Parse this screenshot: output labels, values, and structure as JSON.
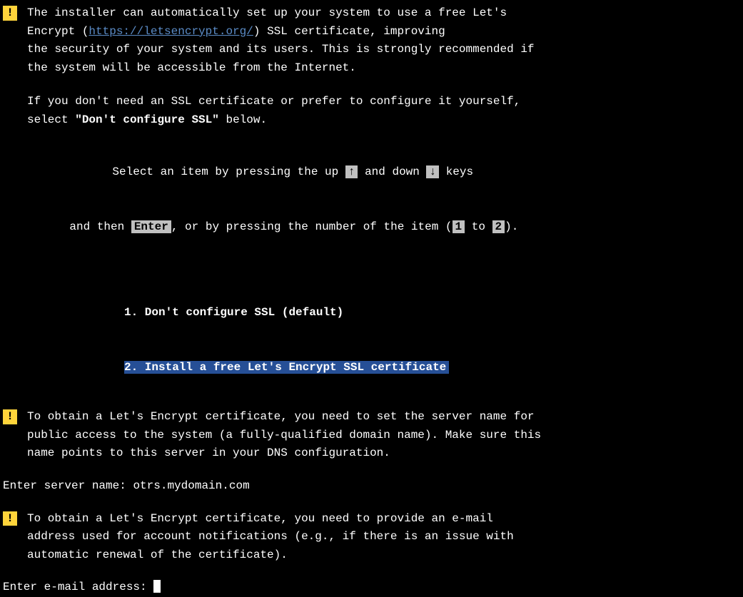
{
  "badge": "!",
  "para1_pre": "The installer can automatically set up your system to use a free Let's\nEncrypt (",
  "para1_link": "https://letsencrypt.org/",
  "para1_post": ") SSL certificate, improving\nthe security of your system and its users. This is strongly recommended if\nthe system will be accessible from the Internet.",
  "para1_b_pre": "If you don't need an SSL certificate or prefer to configure it yourself,\nselect ",
  "para1_b_bold": "\"Don't configure SSL\"",
  "para1_b_post": " below.",
  "nav_l1_pre": "Select an item by pressing the up ",
  "nav_up": "↑",
  "nav_l1_mid": " and down ",
  "nav_down": "↓",
  "nav_l1_post": " keys",
  "nav_l2_pre": "and then ",
  "nav_enter": "Enter",
  "nav_l2_mid": ", or by pressing the number of the item (",
  "nav_k1": "1",
  "nav_l2_to": " to ",
  "nav_k2": "2",
  "nav_l2_post": ").",
  "menu": {
    "opt1": "1. Don't configure SSL (default)",
    "opt2": "2. Install a free Let's Encrypt SSL certificate"
  },
  "para2": "To obtain a Let's Encrypt certificate, you need to set the server name for\npublic access to the system (a fully-qualified domain name). Make sure this\nname points to this server in your DNS configuration.",
  "prompt1_label": "Enter server name: ",
  "prompt1_value": "otrs.mydomain.com",
  "para3": "To obtain a Let's Encrypt certificate, you need to provide an e-mail\naddress used for account notifications (e.g., if there is an issue with\nautomatic renewal of the certificate).",
  "prompt2_label": "Enter e-mail address: "
}
